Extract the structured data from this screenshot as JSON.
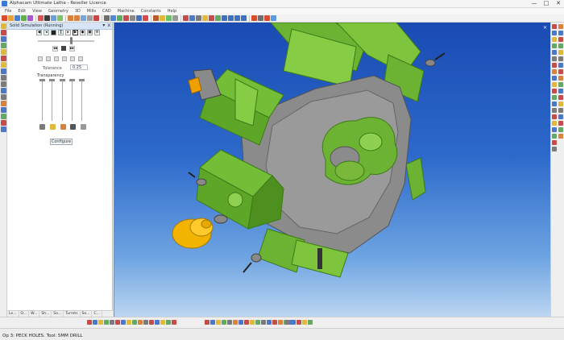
{
  "window": {
    "title": "Alphacam Ultimate Lathe - Reseller Licence",
    "controls": {
      "minimize": "—",
      "maximize": "□",
      "close": "✕"
    }
  },
  "menu": [
    "File",
    "Edit",
    "View",
    "Geometry",
    "3D",
    "Mills",
    "CAD",
    "Machine",
    "Constants",
    "Help"
  ],
  "panel": {
    "title": "Solid Simulation (Running)",
    "header_buttons": {
      "pin": "▾",
      "close": "x"
    },
    "tolerance_label": "Tolerance",
    "tolerance_value": "0.25",
    "transparency_label": "Transparency",
    "configure_label": "Configure",
    "tabs": [
      "Le...",
      "O...",
      "W...",
      "Sh...",
      "So...",
      "Turrets",
      "Se...",
      "C..."
    ]
  },
  "status": {
    "text": "Op 3: PECK HOLES. Tool: 5MM DRILL"
  },
  "colors": {
    "accent": "#3b7bd3",
    "part_green": "#79c23c",
    "turret_gray": "#8a8a8a",
    "chuck_gold": "#f0b400",
    "viewport_top": "#1a4bb3",
    "viewport_bottom": "#bcd6f1"
  }
}
